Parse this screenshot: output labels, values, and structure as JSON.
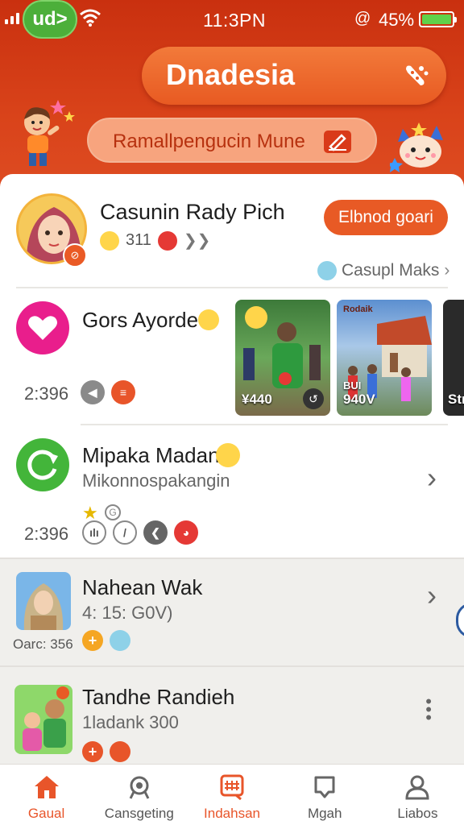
{
  "status_bar": {
    "app_badge": "ud>",
    "time": "11:3PN",
    "alarm_icon": "@",
    "battery_percent": "45%"
  },
  "header": {
    "title": "Dnadesia",
    "search_text": "Ramallpengucin Mune"
  },
  "profile": {
    "name": "Casunin Rady Pich",
    "stat_count": "311",
    "action_button": "Elbnod goari",
    "casual_link": "Casupl Maks"
  },
  "rows": [
    {
      "title": "Gors Ayorde",
      "meta": "2:396",
      "thumbs": [
        {
          "label": "¥440"
        },
        {
          "label": "940V",
          "tag": "BUI",
          "sign": "Rodaik"
        },
        {
          "label": "Str"
        }
      ]
    },
    {
      "title": "Mipaka Madan",
      "subtitle": "Mikonnospakangin",
      "meta": "2:396"
    },
    {
      "title": "Nahean Wak",
      "subtitle": "4: 15: G0V)",
      "meta": "Oarc: 356"
    },
    {
      "title": "Tandhe Randieh",
      "subtitle": "1ladank 300"
    }
  ],
  "bottom_nav": [
    {
      "label": "Gaual",
      "icon": "home-icon",
      "active": true
    },
    {
      "label": "Cansgeting",
      "icon": "badge-icon",
      "active": false
    },
    {
      "label": "Indahsan",
      "icon": "grid-icon",
      "active": true
    },
    {
      "label": "Mgah",
      "icon": "chat-icon",
      "active": false
    },
    {
      "label": "Liabos",
      "icon": "person-icon",
      "active": false
    }
  ],
  "colors": {
    "brand": "#d9431a",
    "accent": "#e85a25",
    "green": "#4caf3a",
    "pink": "#e91e8c"
  }
}
